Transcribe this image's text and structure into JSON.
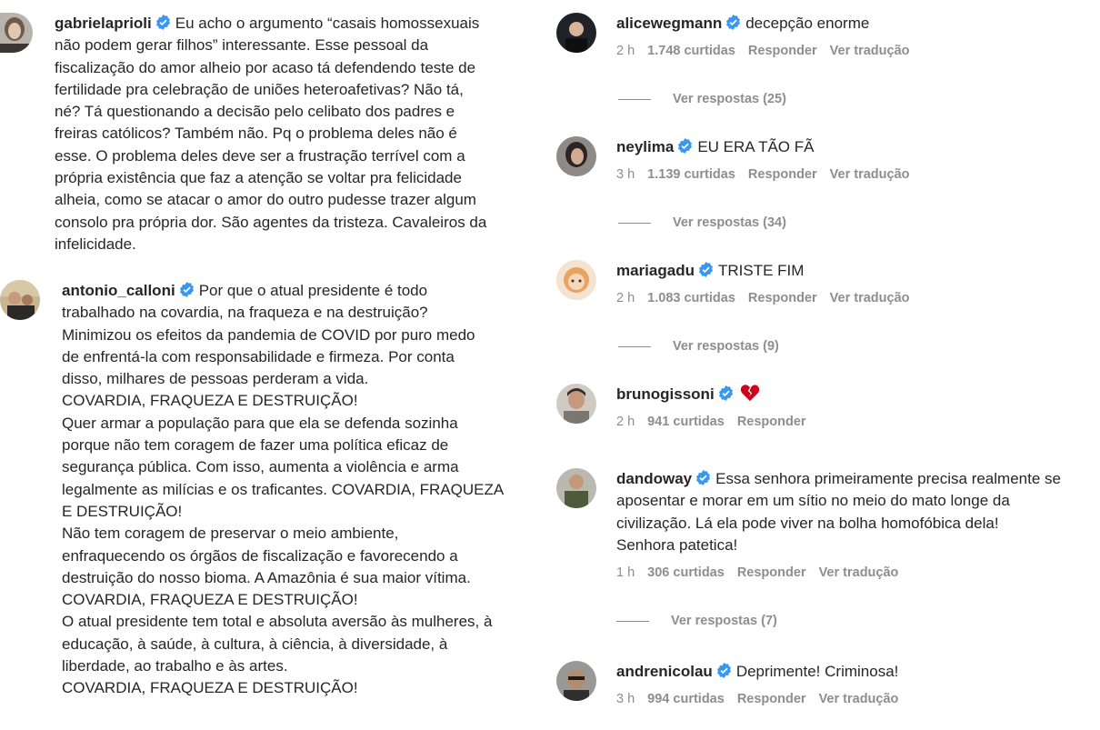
{
  "colors": {
    "verified": "#3897f0",
    "meta": "#8e8e8e",
    "text": "#262626",
    "heart": "#d0021b"
  },
  "left_comments": [
    {
      "username": "gabrielaprioli",
      "lines": [
        "Eu acho o argumento “casais homossexuais",
        "não podem gerar filhos” interessante. Esse pessoal da",
        "fiscalização do amor alheio por acaso tá defendendo teste de",
        "fertilidade pra celebração de uniões heteroafetivas? Não tá,",
        "né? Tá questionando a decisão pelo celibato dos padres e",
        "freiras católicos? Também não. Pq o problema deles não é",
        "esse. O problema deles deve ser a frustração terrível com a",
        "própria existência que faz a atenção se voltar pra felicidade",
        "alheia, como se atacar o amor do outro pudesse trazer algum",
        "consolo pra própria dor. São agentes da tristeza. Cavaleiros da",
        "infelicidade."
      ]
    },
    {
      "username": "antonio_calloni",
      "lines": [
        "Por que o atual presidente é todo",
        "trabalhado na covardia, na fraqueza e na destruição?",
        "Minimizou os efeitos da pandemia de COVID por puro medo",
        "de enfrentá-la com responsabilidade e firmeza. Por conta",
        "disso, milhares de pessoas perderam a vida.",
        "COVARDIA, FRAQUEZA E DESTRUIÇÃO!",
        "Quer armar a população para que ela se defenda sozinha",
        "porque não tem coragem de fazer uma política eficaz de",
        "segurança pública. Com isso, aumenta a violência e arma",
        "legalmente as milícias e os traficantes. COVARDIA, FRAQUEZA",
        "E DESTRUIÇÃO!",
        "Não tem coragem de preservar o meio ambiente,",
        "enfraquecendo os órgãos de fiscalização e favorecendo a",
        "destruição do nosso bioma. A Amazônia é sua maior vítima.",
        "COVARDIA, FRAQUEZA E DESTRUIÇÃO!",
        "O atual presidente tem total e absoluta aversão às mulheres, à",
        "educação, à saúde, à cultura, à ciência, à diversidade, à",
        "liberdade, ao trabalho e às artes.",
        "COVARDIA, FRAQUEZA E DESTRUIÇÃO!"
      ]
    }
  ],
  "right_comments": [
    {
      "username": "alicewegmann",
      "text": "decepção enorme",
      "time": "2 h",
      "likes": "1.748 curtidas",
      "reply": "Responder",
      "translate": "Ver tradução",
      "replies": "Ver respostas (25)"
    },
    {
      "username": "neylima",
      "text": "EU ERA TÃO FÃ",
      "time": "3 h",
      "likes": "1.139 curtidas",
      "reply": "Responder",
      "translate": "Ver tradução",
      "replies": "Ver respostas (34)"
    },
    {
      "username": "mariagadu",
      "text": "TRISTE FIM",
      "time": "2 h",
      "likes": "1.083 curtidas",
      "reply": "Responder",
      "translate": "Ver tradução",
      "replies": "Ver respostas (9)"
    },
    {
      "username": "brunogissoni",
      "text": "",
      "time": "2 h",
      "likes": "941 curtidas",
      "reply": "Responder"
    },
    {
      "username": "dandoway",
      "lines": [
        "Essa senhora primeiramente precisa realmente se",
        "aposentar e morar em um sítio no meio do mato longe da",
        "civilização. Lá ela pode viver na bolha homofóbica dela!",
        "Senhora patetica!"
      ],
      "time": "1 h",
      "likes": "306 curtidas",
      "reply": "Responder",
      "translate": "Ver tradução",
      "replies": "Ver respostas (7)"
    },
    {
      "username": "andrenicolau",
      "text": "Deprimente! Criminosa!",
      "time": "3 h",
      "likes": "994 curtidas",
      "reply": "Responder",
      "translate": "Ver tradução"
    }
  ]
}
